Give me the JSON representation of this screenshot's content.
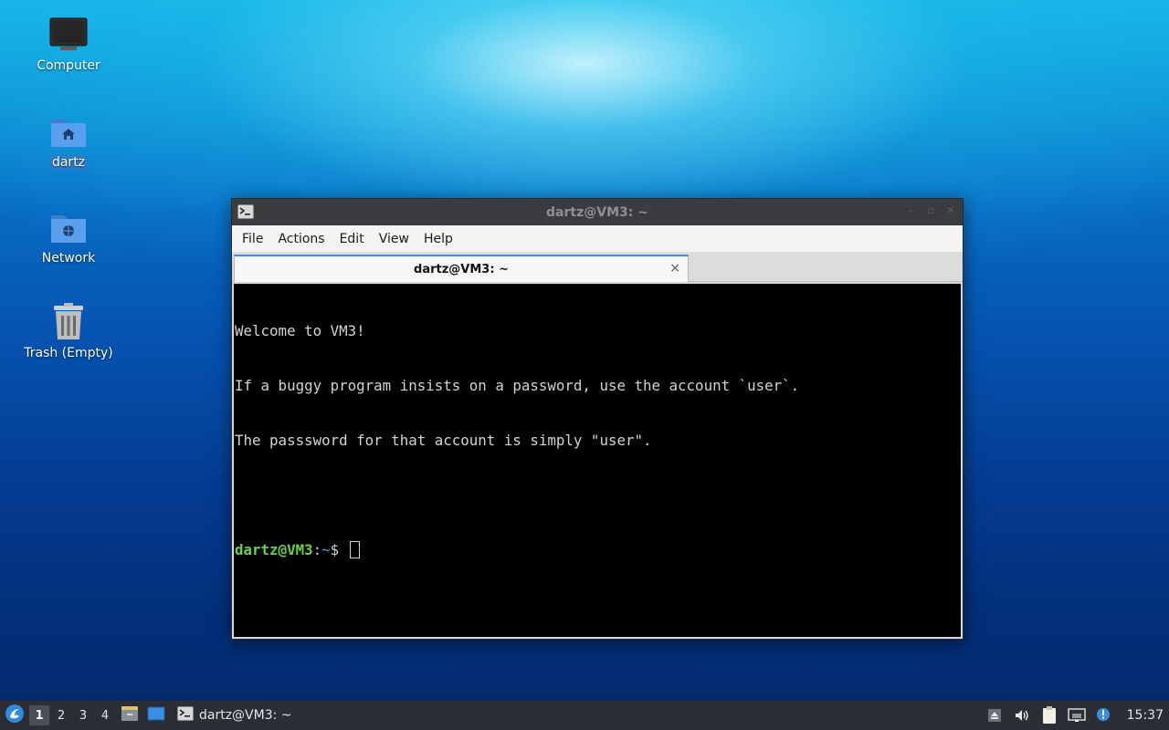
{
  "desktop": {
    "icons": [
      {
        "label": "Computer",
        "icon": "computer-icon"
      },
      {
        "label": "dartz",
        "icon": "home-folder-icon"
      },
      {
        "label": "Network",
        "icon": "network-folder-icon"
      },
      {
        "label": "Trash (Empty)",
        "icon": "trash-icon"
      }
    ]
  },
  "window": {
    "title": "dartz@VM3: ~",
    "menu": [
      "File",
      "Actions",
      "Edit",
      "View",
      "Help"
    ],
    "tab_label": "dartz@VM3: ~",
    "tab_close": "×",
    "terminal": {
      "lines": [
        "Welcome to VM3!",
        "If a buggy program insists on a password, use the account `user`.",
        "The passsword for that account is simply \"user\"."
      ],
      "prompt_user": "dartz@VM3",
      "prompt_sep": ":",
      "prompt_path": "~",
      "prompt_symbol": "$ "
    }
  },
  "taskbar": {
    "workspaces": [
      "1",
      "2",
      "3",
      "4"
    ],
    "active_workspace": "1",
    "task_label": "dartz@VM3: ~",
    "clock": "15:37"
  },
  "colors": {
    "prompt_user": "#6ad14a",
    "prompt_path": "#6a8fe8",
    "tab_accent": "#3d8ee8",
    "taskbar_bg": "#2b2e34"
  }
}
